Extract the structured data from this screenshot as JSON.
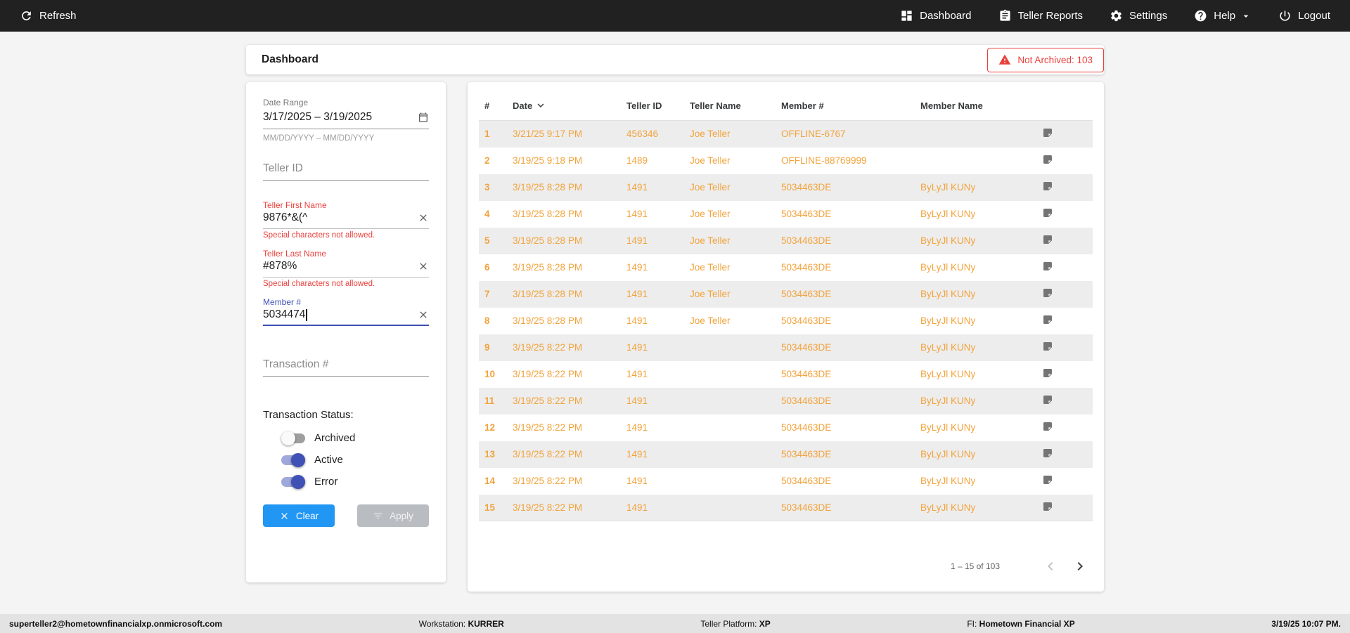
{
  "colors": {
    "topbar_bg": "#212121",
    "amber": "#F2A33C",
    "red": "#E9403C",
    "blue": "#2196F3",
    "indigo": "#3F51B5"
  },
  "topbar": {
    "refresh_label": "Refresh",
    "nav": {
      "dashboard": "Dashboard",
      "teller_reports": "Teller Reports",
      "settings": "Settings",
      "help": "Help",
      "logout": "Logout"
    }
  },
  "page": {
    "title": "Dashboard",
    "not_archived_badge": "Not Archived: 103"
  },
  "filters": {
    "date_range": {
      "label": "Date Range",
      "value": "3/17/2025 – 3/19/2025",
      "helper": "MM/DD/YYYY – MM/DD/YYYY"
    },
    "teller_id": {
      "placeholder": "Teller ID",
      "value": ""
    },
    "teller_first_name": {
      "label": "Teller First Name",
      "value": "9876*&(^",
      "error": "Special characters not allowed."
    },
    "teller_last_name": {
      "label": "Teller Last Name",
      "value": "#878%",
      "error": "Special characters not allowed."
    },
    "member_number": {
      "label": "Member #",
      "value": "5034474"
    },
    "transaction_number": {
      "placeholder": "Transaction #",
      "value": ""
    },
    "transaction_status": {
      "label": "Transaction Status:",
      "toggles": [
        {
          "label": "Archived",
          "on": false
        },
        {
          "label": "Active",
          "on": true
        },
        {
          "label": "Error",
          "on": true
        }
      ]
    },
    "clear_label": "Clear",
    "apply_label": "Apply"
  },
  "table": {
    "columns": {
      "num": "#",
      "date": "Date",
      "teller_id": "Teller ID",
      "teller_name": "Teller Name",
      "member_num": "Member #",
      "member_name": "Member Name"
    },
    "rows": [
      {
        "num": "1",
        "date": "3/21/25 9:17 PM",
        "teller_id": "456346",
        "teller_name": "Joe Teller",
        "member_num": "OFFLINE-6767",
        "member_name": ""
      },
      {
        "num": "2",
        "date": "3/19/25 9:18 PM",
        "teller_id": "1489",
        "teller_name": "Joe Teller",
        "member_num": "OFFLINE-88769999",
        "member_name": ""
      },
      {
        "num": "3",
        "date": "3/19/25 8:28 PM",
        "teller_id": "1491",
        "teller_name": "Joe Teller",
        "member_num": "5034463DE",
        "member_name": "ByLyJl KUNy"
      },
      {
        "num": "4",
        "date": "3/19/25 8:28 PM",
        "teller_id": "1491",
        "teller_name": "Joe Teller",
        "member_num": "5034463DE",
        "member_name": "ByLyJl KUNy"
      },
      {
        "num": "5",
        "date": "3/19/25 8:28 PM",
        "teller_id": "1491",
        "teller_name": "Joe Teller",
        "member_num": "5034463DE",
        "member_name": "ByLyJl KUNy"
      },
      {
        "num": "6",
        "date": "3/19/25 8:28 PM",
        "teller_id": "1491",
        "teller_name": "Joe Teller",
        "member_num": "5034463DE",
        "member_name": "ByLyJl KUNy"
      },
      {
        "num": "7",
        "date": "3/19/25 8:28 PM",
        "teller_id": "1491",
        "teller_name": "Joe Teller",
        "member_num": "5034463DE",
        "member_name": "ByLyJl KUNy"
      },
      {
        "num": "8",
        "date": "3/19/25 8:28 PM",
        "teller_id": "1491",
        "teller_name": "Joe Teller",
        "member_num": "5034463DE",
        "member_name": "ByLyJl KUNy"
      },
      {
        "num": "9",
        "date": "3/19/25 8:22 PM",
        "teller_id": "1491",
        "teller_name": "",
        "member_num": "5034463DE",
        "member_name": "ByLyJl KUNy"
      },
      {
        "num": "10",
        "date": "3/19/25 8:22 PM",
        "teller_id": "1491",
        "teller_name": "",
        "member_num": "5034463DE",
        "member_name": "ByLyJl KUNy"
      },
      {
        "num": "11",
        "date": "3/19/25 8:22 PM",
        "teller_id": "1491",
        "teller_name": "",
        "member_num": "5034463DE",
        "member_name": "ByLyJl KUNy"
      },
      {
        "num": "12",
        "date": "3/19/25 8:22 PM",
        "teller_id": "1491",
        "teller_name": "",
        "member_num": "5034463DE",
        "member_name": "ByLyJl KUNy"
      },
      {
        "num": "13",
        "date": "3/19/25 8:22 PM",
        "teller_id": "1491",
        "teller_name": "",
        "member_num": "5034463DE",
        "member_name": "ByLyJl KUNy"
      },
      {
        "num": "14",
        "date": "3/19/25 8:22 PM",
        "teller_id": "1491",
        "teller_name": "",
        "member_num": "5034463DE",
        "member_name": "ByLyJl KUNy"
      },
      {
        "num": "15",
        "date": "3/19/25 8:22 PM",
        "teller_id": "1491",
        "teller_name": "",
        "member_num": "5034463DE",
        "member_name": "ByLyJl KUNy"
      }
    ],
    "pagination": {
      "range_label": "1 – 15 of 103"
    }
  },
  "footer": {
    "email": "superteller2@hometownfinancialxp.onmicrosoft.com",
    "workstation_label": "Workstation:",
    "workstation": "KURRER",
    "platform_label": "Teller Platform:",
    "platform": "XP",
    "fi_label": "FI:",
    "fi": "Hometown Financial XP",
    "datetime": "3/19/25 10:07 PM."
  }
}
